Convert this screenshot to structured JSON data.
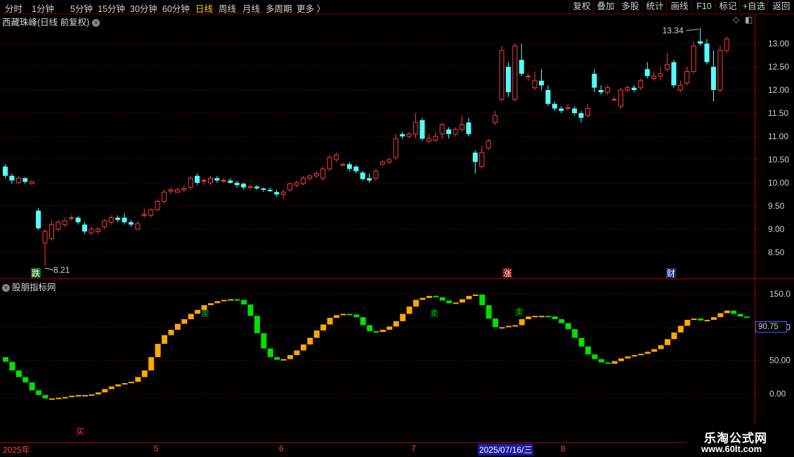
{
  "toolbar": {
    "left": [
      "分时",
      "1分钟",
      "5分钟",
      "15分钟",
      "30分钟",
      "60分钟",
      "日线",
      "周线",
      "月线",
      "多周期",
      "更多 〉"
    ],
    "active": "日线",
    "right": [
      "复权",
      "叠加",
      "多股",
      "统计",
      "画线",
      "F10",
      "+自选",
      "返回",
      "标记"
    ]
  },
  "main": {
    "title": "西藏珠峰(日线 前复权)",
    "high_label": "13.34",
    "low_label": "8.21",
    "price_ticks": [
      "13.00",
      "12.50",
      "12.00",
      "11.50",
      "11.00",
      "10.50",
      "10.00",
      "9.50",
      "9.00",
      "8.50"
    ],
    "markers": [
      "跌",
      "涨",
      "财"
    ]
  },
  "indicator": {
    "title": "股朋指标网",
    "ticks": [
      "150.0",
      "100.0",
      "50.00",
      "0.00"
    ],
    "current_value": "90.75",
    "signals": {
      "buy": "买",
      "sell": "卖"
    }
  },
  "xaxis": {
    "labels": [
      "2025年",
      "5",
      "6",
      "7",
      "8"
    ],
    "current_date": "2025/07/16/三"
  },
  "watermark": {
    "title": "乐淘公式网",
    "url": "www.60lt.com"
  },
  "colors": {
    "up": "#ff3c3c",
    "down": "#54ffff",
    "up_ind": "#ffa800",
    "down_ind": "#00e000",
    "grid": "#7a0000"
  },
  "chart_data": {
    "type": "candlestick",
    "ylim": [
      8.0,
      13.5
    ],
    "candles": [
      [
        10.35,
        10.15,
        10.4,
        10.1
      ],
      [
        10.15,
        10.05,
        10.2,
        9.98
      ],
      [
        10.0,
        10.1,
        10.15,
        9.98
      ],
      [
        10.1,
        10.02,
        10.12,
        9.98
      ],
      [
        9.98,
        10.02,
        10.05,
        9.96
      ],
      [
        9.4,
        9.02,
        9.45,
        8.98
      ],
      [
        8.7,
        8.95,
        9.0,
        8.21
      ],
      [
        8.8,
        9.1,
        9.2,
        8.75
      ],
      [
        9.0,
        9.15,
        9.2,
        8.95
      ],
      [
        9.1,
        9.18,
        9.25,
        9.05
      ],
      [
        9.25,
        9.25,
        9.3,
        9.18
      ],
      [
        9.25,
        9.15,
        9.28,
        9.1
      ],
      [
        9.1,
        8.95,
        9.15,
        8.9
      ],
      [
        8.92,
        9.0,
        9.05,
        8.88
      ],
      [
        8.95,
        9.0,
        9.05,
        8.9
      ],
      [
        9.05,
        9.18,
        9.22,
        9.0
      ],
      [
        9.15,
        9.25,
        9.3,
        9.1
      ],
      [
        9.25,
        9.2,
        9.3,
        9.15
      ],
      [
        9.25,
        9.15,
        9.35,
        9.1
      ],
      [
        9.15,
        9.1,
        9.2,
        9.05
      ],
      [
        9.0,
        9.12,
        9.18,
        8.98
      ],
      [
        9.3,
        9.32,
        9.45,
        9.25
      ],
      [
        9.3,
        9.42,
        9.45,
        9.25
      ],
      [
        9.42,
        9.6,
        9.65,
        9.4
      ],
      [
        9.6,
        9.8,
        9.85,
        9.55
      ],
      [
        9.82,
        9.85,
        9.9,
        9.75
      ],
      [
        9.8,
        9.85,
        9.9,
        9.78
      ],
      [
        9.85,
        9.88,
        9.95,
        9.8
      ],
      [
        9.9,
        10.1,
        10.15,
        9.85
      ],
      [
        10.15,
        10.0,
        10.2,
        9.95
      ],
      [
        10.05,
        10.05,
        10.1,
        9.95
      ],
      [
        10.0,
        10.1,
        10.15,
        9.95
      ],
      [
        10.1,
        10.05,
        10.15,
        10.0
      ],
      [
        10.05,
        10.05,
        10.1,
        10.0
      ],
      [
        10.05,
        10.0,
        10.1,
        9.98
      ],
      [
        10.0,
        9.95,
        10.05,
        9.9
      ],
      [
        9.98,
        9.9,
        10.0,
        9.85
      ],
      [
        9.9,
        9.92,
        9.95,
        9.85
      ],
      [
        9.92,
        9.88,
        9.95,
        9.85
      ],
      [
        9.88,
        9.85,
        9.9,
        9.8
      ],
      [
        9.85,
        9.82,
        9.9,
        9.8
      ],
      [
        9.8,
        9.75,
        9.85,
        9.7
      ],
      [
        9.75,
        9.8,
        9.85,
        9.65
      ],
      [
        9.85,
        9.98,
        10.0,
        9.8
      ],
      [
        9.95,
        10.0,
        10.05,
        9.9
      ],
      [
        9.98,
        10.1,
        10.15,
        9.95
      ],
      [
        10.1,
        10.15,
        10.18,
        10.05
      ],
      [
        10.15,
        10.2,
        10.25,
        10.1
      ],
      [
        10.1,
        10.3,
        10.35,
        10.05
      ],
      [
        10.3,
        10.55,
        10.6,
        10.25
      ],
      [
        10.5,
        10.6,
        10.65,
        10.45
      ],
      [
        10.38,
        10.4,
        10.42,
        10.35
      ],
      [
        10.4,
        10.3,
        10.45,
        10.25
      ],
      [
        10.35,
        10.25,
        10.38,
        10.2
      ],
      [
        10.22,
        10.08,
        10.25,
        10.05
      ],
      [
        10.1,
        10.05,
        10.2,
        10.0
      ],
      [
        10.1,
        10.25,
        10.3,
        10.05
      ],
      [
        10.4,
        10.45,
        10.48,
        10.38
      ],
      [
        10.45,
        10.5,
        10.55,
        10.4
      ],
      [
        10.55,
        10.95,
        11.05,
        10.5
      ],
      [
        11.05,
        11.0,
        11.1,
        10.95
      ],
      [
        11.0,
        11.05,
        11.1,
        10.95
      ],
      [
        11.05,
        11.3,
        11.5,
        10.95
      ],
      [
        11.35,
        10.95,
        11.4,
        10.9
      ],
      [
        10.9,
        10.95,
        11.05,
        10.85
      ],
      [
        10.92,
        11.0,
        11.1,
        10.88
      ],
      [
        11.05,
        11.25,
        11.3,
        10.95
      ],
      [
        11.15,
        11.05,
        11.2,
        10.95
      ],
      [
        11.05,
        11.15,
        11.2,
        11.0
      ],
      [
        11.15,
        11.25,
        11.45,
        11.1
      ],
      [
        11.3,
        11.05,
        11.4,
        11.0
      ],
      [
        10.65,
        10.45,
        10.7,
        10.2
      ],
      [
        10.35,
        10.65,
        10.8,
        10.3
      ],
      [
        10.75,
        10.9,
        10.95,
        10.7
      ],
      [
        11.3,
        11.45,
        11.55,
        11.25
      ],
      [
        11.8,
        12.85,
        12.95,
        11.75
      ],
      [
        12.5,
        11.95,
        12.6,
        11.85
      ],
      [
        11.8,
        12.95,
        13.0,
        11.75
      ],
      [
        12.65,
        12.35,
        13.0,
        12.3
      ],
      [
        12.3,
        12.3,
        12.35,
        12.2
      ],
      [
        12.05,
        12.2,
        12.4,
        12.0
      ],
      [
        12.2,
        12.1,
        12.45,
        12.0
      ],
      [
        12.0,
        11.7,
        12.1,
        11.65
      ],
      [
        11.7,
        11.6,
        11.75,
        11.55
      ],
      [
        11.6,
        11.55,
        11.65,
        11.5
      ],
      [
        11.6,
        11.62,
        11.7,
        11.55
      ],
      [
        11.6,
        11.5,
        11.65,
        11.45
      ],
      [
        11.5,
        11.4,
        11.55,
        11.3
      ],
      [
        11.45,
        11.6,
        11.7,
        11.4
      ],
      [
        12.35,
        12.05,
        12.45,
        11.95
      ],
      [
        12.0,
        11.95,
        12.1,
        11.9
      ],
      [
        11.95,
        12.05,
        12.1,
        11.9
      ],
      [
        11.8,
        11.8,
        11.85,
        11.75
      ],
      [
        11.65,
        12.0,
        12.05,
        11.6
      ],
      [
        12.0,
        12.05,
        12.1,
        11.95
      ],
      [
        12.05,
        12.0,
        12.1,
        11.95
      ],
      [
        12.05,
        12.2,
        12.25,
        12.0
      ],
      [
        12.45,
        12.3,
        12.6,
        12.25
      ],
      [
        12.25,
        12.3,
        12.4,
        12.2
      ],
      [
        12.3,
        12.35,
        12.5,
        12.2
      ],
      [
        12.45,
        12.55,
        12.8,
        12.4
      ],
      [
        12.6,
        12.1,
        12.65,
        12.05
      ],
      [
        12.0,
        12.1,
        12.2,
        11.95
      ],
      [
        12.15,
        12.4,
        12.5,
        12.1
      ],
      [
        12.4,
        12.95,
        13.05,
        12.35
      ],
      [
        13.05,
        13.0,
        13.34,
        12.95
      ],
      [
        13.0,
        12.6,
        13.1,
        12.55
      ],
      [
        12.5,
        12.0,
        12.85,
        11.75
      ],
      [
        12.0,
        12.85,
        12.95,
        11.95
      ],
      [
        12.85,
        13.1,
        13.15,
        12.8
      ]
    ],
    "indicator_values": [
      55,
      48,
      35,
      25,
      17,
      5,
      -2,
      -7,
      -7,
      -6,
      -5,
      -3,
      -2,
      -2,
      -1,
      2,
      7,
      11,
      14,
      16,
      18,
      25,
      35,
      55,
      75,
      88,
      96,
      105,
      112,
      120,
      126,
      133,
      136,
      139,
      141,
      142,
      141,
      134,
      117,
      91,
      68,
      55,
      51,
      52,
      58,
      65,
      74,
      84,
      95,
      104,
      114,
      118,
      120,
      119,
      115,
      103,
      94,
      93,
      96,
      101,
      109,
      120,
      131,
      141,
      144,
      147,
      145,
      140,
      136,
      137,
      142,
      147,
      149,
      133,
      113,
      100,
      100,
      102,
      103,
      112,
      116,
      117,
      117,
      116,
      112,
      106,
      97,
      84,
      71,
      59,
      52,
      47,
      45,
      49,
      53,
      56,
      58,
      60,
      63,
      67,
      73,
      82,
      92,
      102,
      111,
      113,
      110,
      111,
      115,
      121,
      125,
      120,
      116,
      114
    ]
  }
}
